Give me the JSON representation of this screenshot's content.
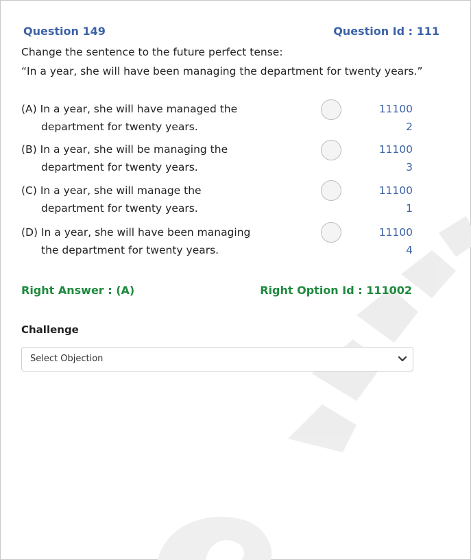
{
  "question": {
    "title": "Question 149",
    "id_label": "Question Id : 111",
    "stem_line1": "Change the sentence to the future perfect tense:",
    "stem_line2": "“In a year, she will have been managing the department for twenty years.”"
  },
  "options": [
    {
      "line1": "(A) In a year, she will have managed the",
      "line2": "department for twenty years.",
      "id_line1": "11100",
      "id_line2": "2"
    },
    {
      "line1": "(B) In a year, she will be managing the",
      "line2": "department for twenty years.",
      "id_line1": "11100",
      "id_line2": "3"
    },
    {
      "line1": "(C) In a year, she will manage the",
      "line2": "department for twenty years.",
      "id_line1": "11100",
      "id_line2": "1"
    },
    {
      "line1": "(D) In a year, she will have been managing",
      "line2": "the department for twenty years.",
      "id_line1": "11100",
      "id_line2": "4"
    }
  ],
  "answer": {
    "right_answer": "Right Answer : (A)",
    "right_option_id": "Right Option Id : 111002"
  },
  "challenge": {
    "label": "Challenge",
    "select_value": "Select Objection"
  },
  "colors": {
    "accent_blue": "#3c62a6",
    "answer_green": "#1e8a3e"
  },
  "icons": {
    "dropdown": "chevron-down-icon"
  }
}
